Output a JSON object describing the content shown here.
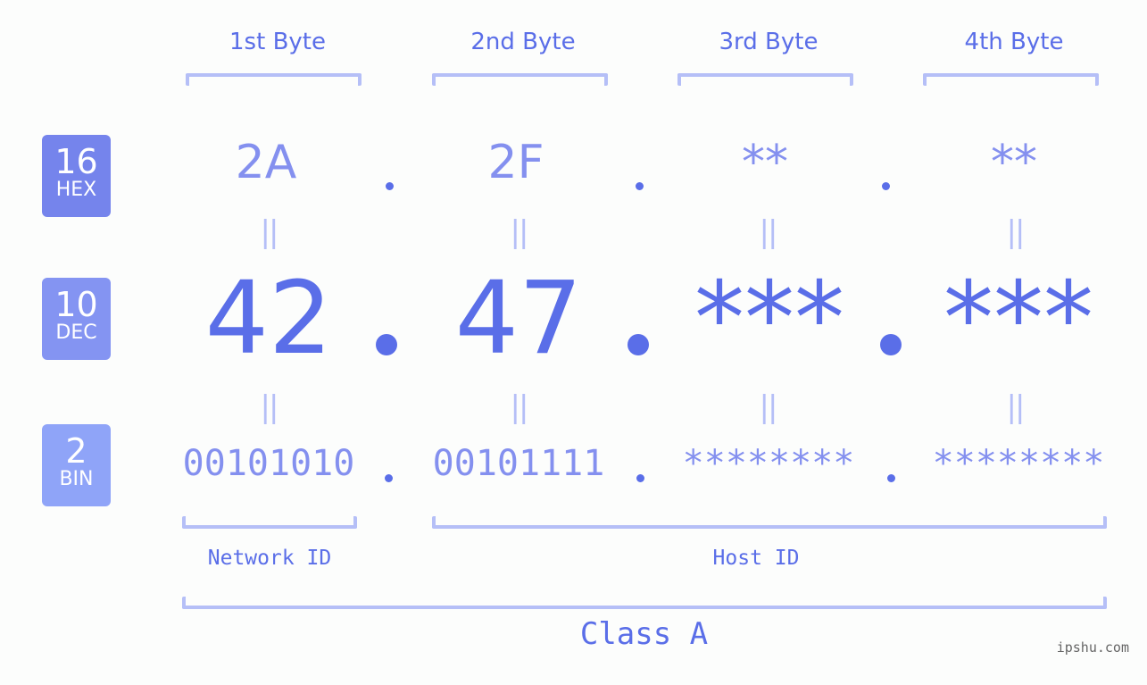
{
  "ip_address": "42.47.***.***",
  "bytes": [
    {
      "label": "1st Byte",
      "hex": "2A",
      "dec": "42",
      "bin": "00101010"
    },
    {
      "label": "2nd Byte",
      "hex": "2F",
      "dec": "47",
      "bin": "00101111"
    },
    {
      "label": "3rd Byte",
      "hex": "**",
      "dec": "***",
      "bin": "********"
    },
    {
      "label": "4th Byte",
      "hex": "**",
      "dec": "***",
      "bin": "********"
    }
  ],
  "bases": {
    "hex": {
      "num": "16",
      "name": "HEX",
      "color": "#7584ec"
    },
    "dec": {
      "num": "10",
      "name": "DEC",
      "color": "#8494f2"
    },
    "bin": {
      "num": "2",
      "name": "BIN",
      "color": "#8fa4f8"
    }
  },
  "equals_symbol": "||",
  "network_id_label": "Network ID",
  "host_id_label": "Host ID",
  "class_label": "Class A",
  "watermark": "ipshu.com",
  "colors": {
    "primary": "#5a6ee8",
    "secondary": "#8490ef",
    "bracket": "#b5bff7",
    "background": "#fcfdfc"
  }
}
